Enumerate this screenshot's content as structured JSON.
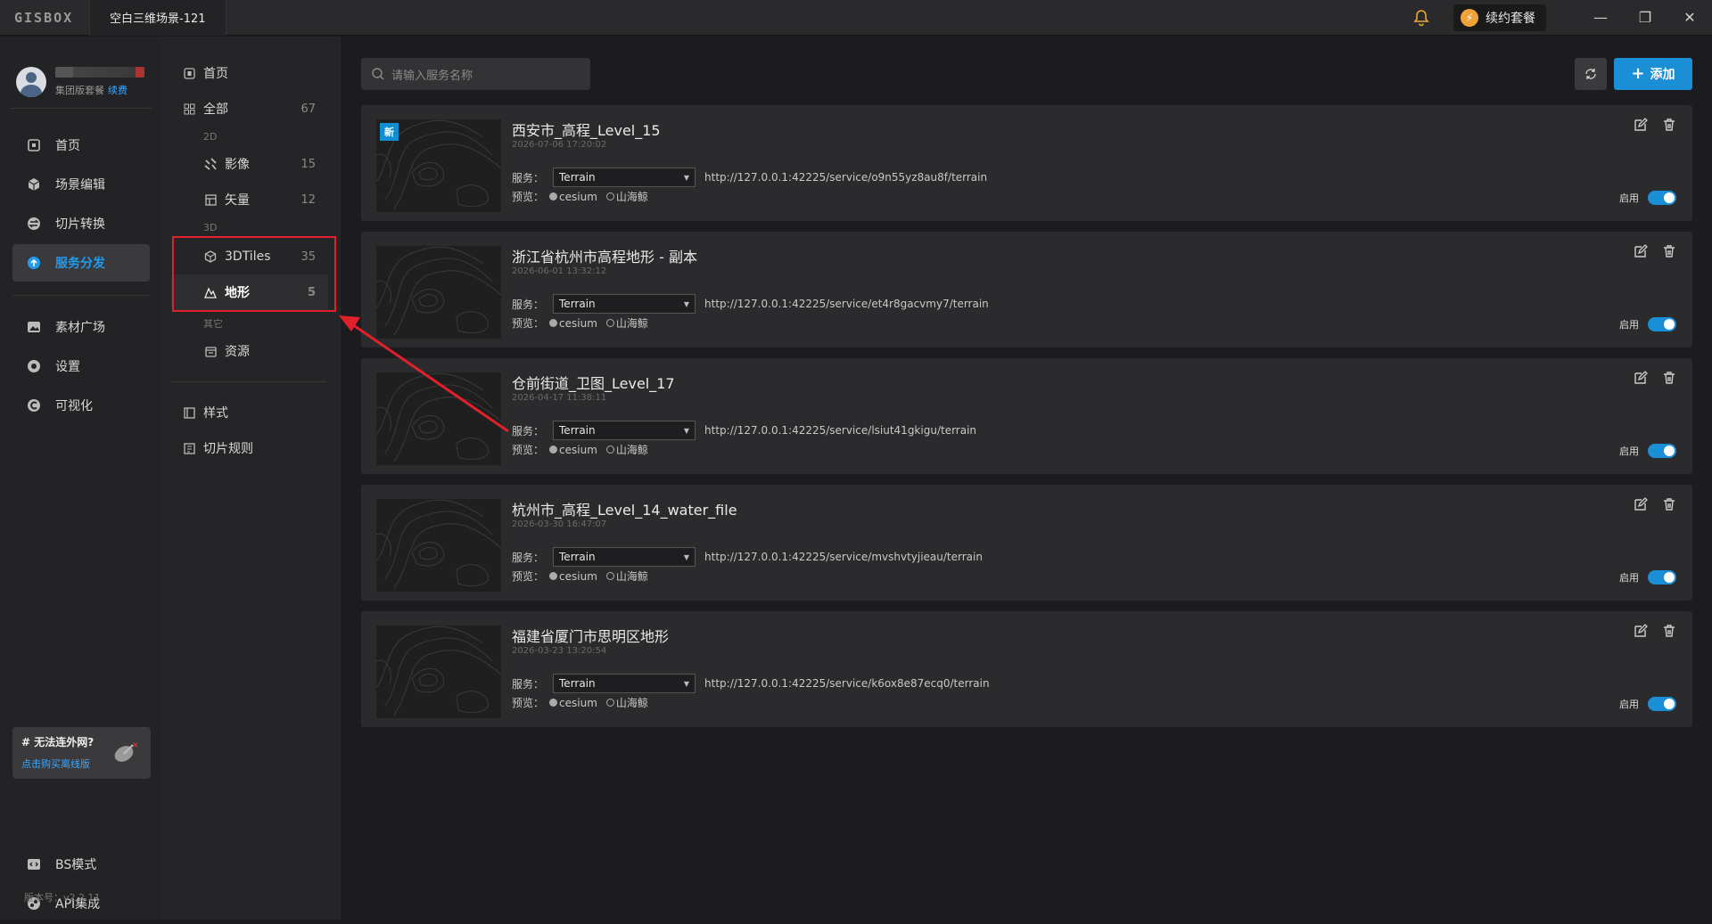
{
  "app": {
    "logo": "GISBOX",
    "tab_title": "空白三维场景-121",
    "renew_label": "续约套餐"
  },
  "profile": {
    "plan": "集团版套餐",
    "renew_link": "续费"
  },
  "main_nav": [
    {
      "label": "首页",
      "icon": "home-icon"
    },
    {
      "label": "场景编辑",
      "icon": "cube-icon"
    },
    {
      "label": "切片转换",
      "icon": "convert-icon"
    },
    {
      "label": "服务分发",
      "icon": "upload-icon",
      "active": true
    },
    {
      "label": "素材广场",
      "icon": "image-icon"
    },
    {
      "label": "设置",
      "icon": "gear-icon"
    },
    {
      "label": "可视化",
      "icon": "chart-icon"
    }
  ],
  "offline": {
    "title": "# 无法连外网?",
    "link": "点击购买离线版"
  },
  "bottom_nav": [
    {
      "label": "BS模式",
      "icon": "code-icon"
    },
    {
      "label": "API集成",
      "icon": "api-icon"
    }
  ],
  "version": "版本号：v2.2.11",
  "sub_nav": {
    "home": "首页",
    "all": {
      "label": "全部",
      "count": "67"
    },
    "group_2d": "2D",
    "imagery": {
      "label": "影像",
      "count": "15"
    },
    "vector": {
      "label": "矢量",
      "count": "12"
    },
    "group_3d": "3D",
    "tiles3d": {
      "label": "3DTiles",
      "count": "35"
    },
    "terrain": {
      "label": "地形",
      "count": "5"
    },
    "group_other": "其它",
    "resource": "资源",
    "style": "样式",
    "tile_rules": "切片规则"
  },
  "toolbar": {
    "search_placeholder": "请输入服务名称",
    "add_label": "添加"
  },
  "labels": {
    "service": "服务：",
    "preview": "预览：",
    "cesium": "cesium",
    "shanhaijing": "山海鲸",
    "enabled": "启用",
    "new": "新"
  },
  "services": [
    {
      "title": "西安市_高程_Level_15",
      "date": "2026-07-06 17:20:02",
      "type": "Terrain",
      "url": "http://127.0.0.1:42225/service/o9n55yz8au8f/terrain",
      "is_new": true,
      "enabled": true
    },
    {
      "title": "浙江省杭州市高程地形 - 副本",
      "date": "2026-06-01 13:32:12",
      "type": "Terrain",
      "url": "http://127.0.0.1:42225/service/et4r8gacvmy7/terrain",
      "is_new": false,
      "enabled": true
    },
    {
      "title": "仓前街道_卫图_Level_17",
      "date": "2026-04-17 11:38:11",
      "type": "Terrain",
      "url": "http://127.0.0.1:42225/service/lsiut41gkigu/terrain",
      "is_new": false,
      "enabled": true
    },
    {
      "title": "杭州市_高程_Level_14_water_file",
      "date": "2026-03-30 16:47:07",
      "type": "Terrain",
      "url": "http://127.0.0.1:42225/service/mvshvtyjieau/terrain",
      "is_new": false,
      "enabled": true
    },
    {
      "title": "福建省厦门市思明区地形",
      "date": "2026-03-23 13:20:54",
      "type": "Terrain",
      "url": "http://127.0.0.1:42225/service/k6ox8e87ecq0/terrain",
      "is_new": false,
      "enabled": true
    }
  ]
}
